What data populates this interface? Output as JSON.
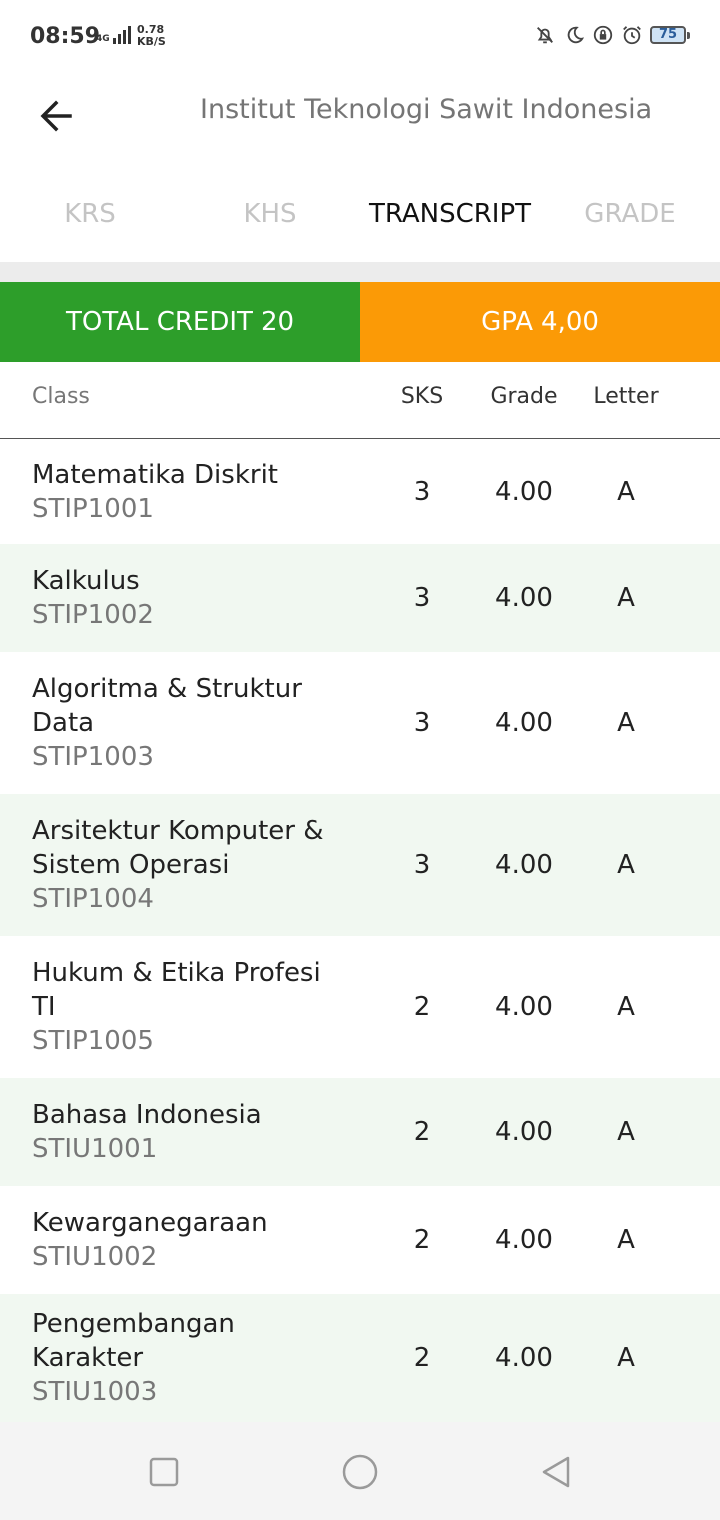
{
  "status_bar": {
    "time": "08:59",
    "network": "4G",
    "speed_value": "0.78",
    "speed_unit": "KB/S",
    "battery": "75"
  },
  "app_bar": {
    "title": "Institut Teknologi Sawit Indonesia"
  },
  "tabs": [
    {
      "label": "KRS",
      "active": false
    },
    {
      "label": "KHS",
      "active": false
    },
    {
      "label": "TRANSCRIPT",
      "active": true
    },
    {
      "label": "GRADE",
      "active": false
    }
  ],
  "summary": {
    "credit_label": "TOTAL CREDIT",
    "credit_value": "20",
    "gpa_label": "GPA",
    "gpa_value": "4,00",
    "credit_color": "#2d9e2a",
    "gpa_color": "#fb9a06"
  },
  "table": {
    "headers": {
      "class": "Class",
      "sks": "SKS",
      "grade": "Grade",
      "letter": "Letter"
    },
    "rows": [
      {
        "name": "Matematika Diskrit",
        "code": "STIP1001",
        "sks": "3",
        "grade": "4.00",
        "letter": "A"
      },
      {
        "name": "Kalkulus",
        "code": "STIP1002",
        "sks": "3",
        "grade": "4.00",
        "letter": "A"
      },
      {
        "name": "Algoritma & Struktur Data",
        "code": "STIP1003",
        "sks": "3",
        "grade": "4.00",
        "letter": "A"
      },
      {
        "name": "Arsitektur Komputer & Sistem Operasi",
        "code": "STIP1004",
        "sks": "3",
        "grade": "4.00",
        "letter": "A"
      },
      {
        "name": "Hukum & Etika Profesi TI",
        "code": "STIP1005",
        "sks": "2",
        "grade": "4.00",
        "letter": "A"
      },
      {
        "name": "Bahasa Indonesia",
        "code": "STIU1001",
        "sks": "2",
        "grade": "4.00",
        "letter": "A"
      },
      {
        "name": "Kewarganegaraan",
        "code": "STIU1002",
        "sks": "2",
        "grade": "4.00",
        "letter": "A"
      },
      {
        "name": "Pengembangan Karakter",
        "code": "STIU1003",
        "sks": "2",
        "grade": "4.00",
        "letter": "A"
      }
    ]
  },
  "icons": {
    "back": "arrow-left-icon",
    "nav_recent": "square-icon",
    "nav_home": "circle-icon",
    "nav_back": "triangle-back-icon"
  }
}
